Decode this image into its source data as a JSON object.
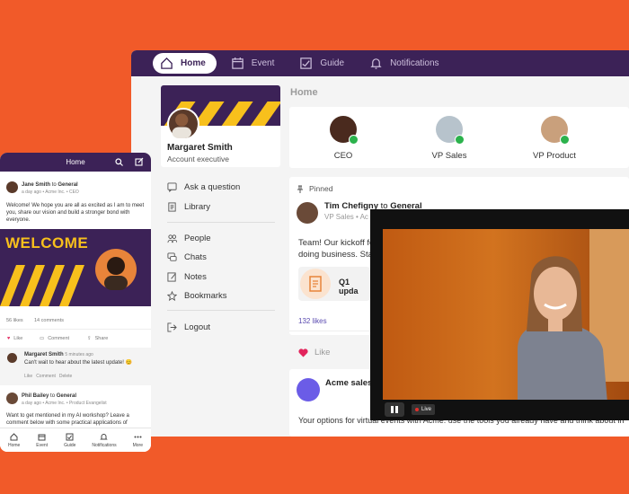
{
  "topnav": {
    "home": "Home",
    "event": "Event",
    "guide": "Guide",
    "notifications": "Notifications"
  },
  "section_title": "Home",
  "profile": {
    "name": "Margaret Smith",
    "title": "Account executive"
  },
  "left_nav": {
    "ask": "Ask a question",
    "library": "Library",
    "people": "People",
    "chats": "Chats",
    "notes": "Notes",
    "bookmarks": "Bookmarks",
    "logout": "Logout"
  },
  "leaders": [
    {
      "label": "CEO"
    },
    {
      "label": "VP Sales"
    },
    {
      "label": "VP Product"
    }
  ],
  "post": {
    "pinned": "Pinned",
    "author": "Tim Chefigny",
    "to": "to",
    "group": "General",
    "role": "VP Sales • Ac",
    "body_line1": "Team! Our kickoff fo",
    "body_line2": "doing business. Sta",
    "attachment": "Q1 upda",
    "likes": "132 likes",
    "like_btn": "Like"
  },
  "post2": {
    "author": "Acme sales",
    "body": "Your options for virtual events with Acme: use the tools you already have and think about in"
  },
  "video": {
    "live": "Live"
  },
  "phone": {
    "title": "Home",
    "post1_author": "Jane Smith",
    "post1_to": "to",
    "post1_group": "General",
    "post1_meta": "a day ago • Acme Inc. • CEO",
    "post1_body": "Welcome! We hope you are all as excited as I am to meet you, share our vision and build a stronger bond with everyone.",
    "welcome_text": "WELCOME",
    "likes": "56 likes",
    "comments": "14 comments",
    "like": "Like",
    "comment": "Comment",
    "share": "Share",
    "c_author": "Margaret Smith",
    "c_time": "5 minutes ago",
    "c_body": "Can't wait to hear about the latest update! 😊",
    "c_like": "Like",
    "c_comment": "Comment",
    "c_delete": "Delete",
    "post2_author": "Phil Bailey",
    "post2_to": "to",
    "post2_group": "General",
    "post2_meta": "a day ago • Acme Inc. • Product Evangelist",
    "post2_body": "Want to get mentioned in my AI workshop? Leave a comment below with some practical applications of",
    "nav": [
      "Home",
      "Event",
      "Guide",
      "Notifications",
      "More"
    ]
  },
  "colors": {
    "brand": "#3c2257",
    "accent": "#f8c01c",
    "background": "#f15a29",
    "like": "#e2245c"
  }
}
